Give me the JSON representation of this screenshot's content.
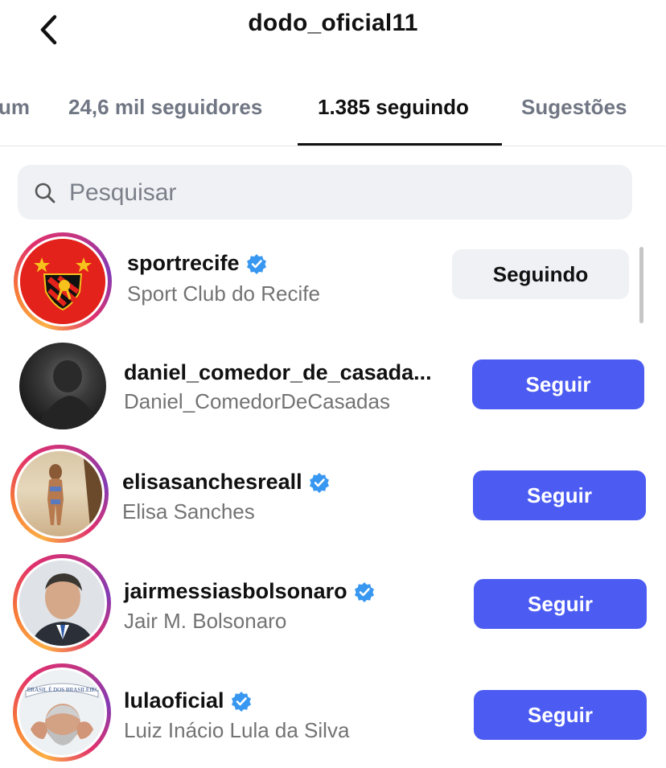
{
  "header": {
    "title": "dodo_oficial11",
    "back_icon": "chevron-left-icon"
  },
  "tabs": [
    {
      "label": "um",
      "active": false
    },
    {
      "label": "24,6 mil seguidores",
      "active": false
    },
    {
      "label": "1.385 seguindo",
      "active": true
    },
    {
      "label": "Sugestões",
      "active": false
    }
  ],
  "search": {
    "placeholder": "Pesquisar",
    "value": "",
    "icon": "search-icon"
  },
  "accounts": [
    {
      "username": "sportrecife",
      "full_name": "Sport Club do Recife",
      "verified": true,
      "button": "Seguindo",
      "state": "following"
    },
    {
      "username": "daniel_comedor_de_casada...",
      "full_name": "Daniel_ComedorDeCasadas",
      "verified": false,
      "button": "Seguir",
      "state": "follow"
    },
    {
      "username": "elisasanchesreall",
      "full_name": "Elisa Sanches",
      "verified": true,
      "button": "Seguir",
      "state": "follow"
    },
    {
      "username": "jairmessiasbolsonaro",
      "full_name": "Jair M. Bolsonaro",
      "verified": true,
      "button": "Seguir",
      "state": "follow"
    },
    {
      "username": "lulaoficial",
      "full_name": "Luiz Inácio Lula da Silva",
      "verified": true,
      "button": "Seguir",
      "state": "follow"
    }
  ],
  "avatar_texts": {
    "lula_banner": "O BRASIL É DOS BRASILEIROS"
  },
  "colors": {
    "follow_button": "#4c5cf2",
    "following_button": "#eff1f5",
    "verified_badge": "#3897f0",
    "secondary_text": "#737373"
  }
}
